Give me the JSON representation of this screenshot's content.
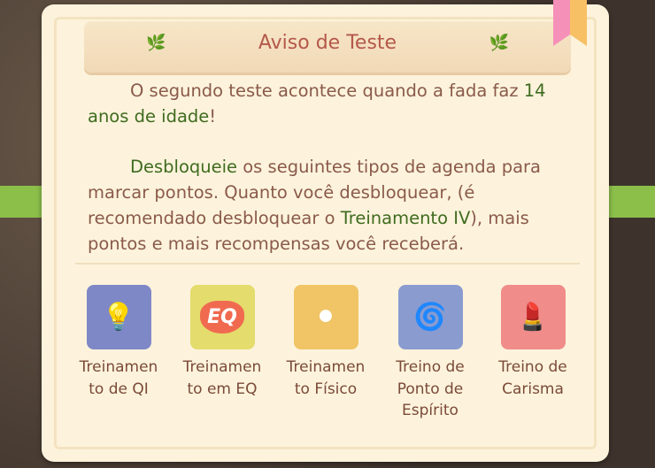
{
  "dialog": {
    "title": "Aviso de Teste",
    "para1": {
      "text1": "O segundo teste acontece quando a fada faz",
      "highlight": "14 anos de idade",
      "text2": "!"
    },
    "para2": {
      "highlight1": "Desbloqueie",
      "text1": " os seguintes tipos de agenda para marcar pontos. Quanto você desbloquear, (é recomendado desbloquear o ",
      "highlight2": "Treinamento IV",
      "text2": "), mais pontos e mais recompensas você receberá."
    }
  },
  "items": [
    {
      "label1": "Treinamen",
      "label2": "to de QI",
      "label3": "",
      "icon": "lightbulb-icon",
      "color": "#7f88c6"
    },
    {
      "label1": "Treinamen",
      "label2": "to em EQ",
      "label3": "",
      "icon": "heart-eq-icon",
      "color": "#e4dc6c",
      "glyph": "EQ"
    },
    {
      "label1": "Treinamen",
      "label2": "to Físico",
      "label3": "",
      "icon": "dumbbell-icon",
      "color": "#f1c466"
    },
    {
      "label1": "Treino de",
      "label2": "Ponto de",
      "label3": "Espírito",
      "icon": "spiral-orb-icon",
      "color": "#8a9bd0"
    },
    {
      "label1": "Treino de",
      "label2": "Carisma",
      "label3": "",
      "icon": "lipstick-icon",
      "color": "#f08c8a"
    }
  ]
}
